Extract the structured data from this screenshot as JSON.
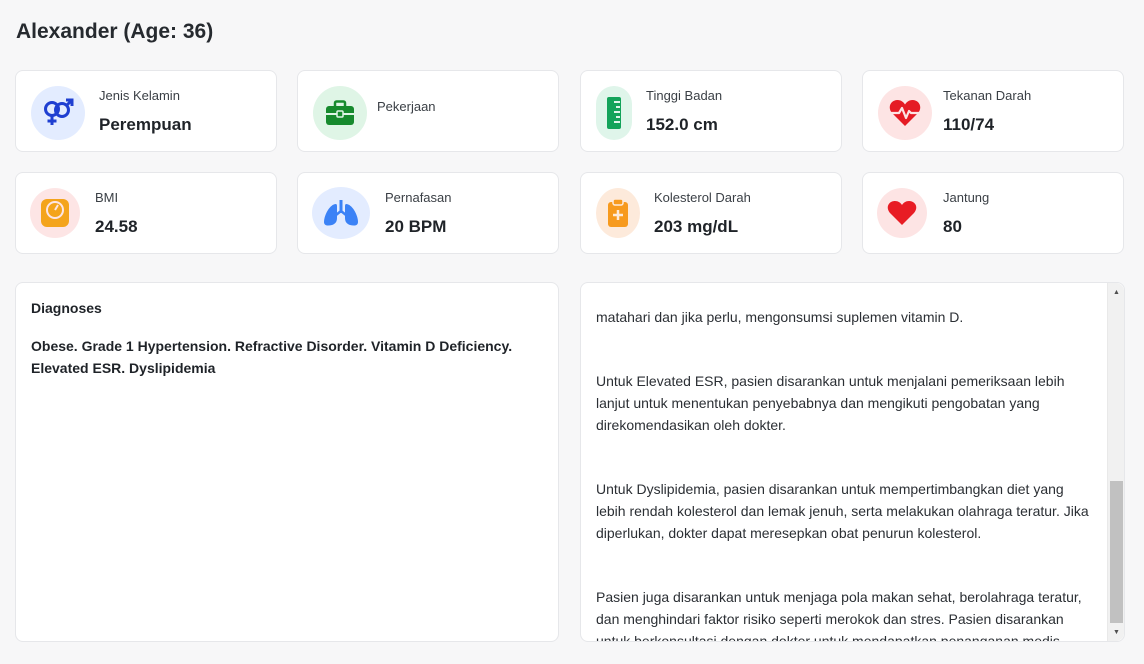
{
  "patient": {
    "title": "Alexander (Age: 36)"
  },
  "cards": [
    {
      "name": "gender",
      "label": "Jenis Kelamin",
      "value": "Perempuan",
      "icon": "gender-icon",
      "bg": "#e3ecff",
      "color": "#1f3fd1"
    },
    {
      "name": "occupation",
      "label": "Pekerjaan",
      "value": "",
      "icon": "briefcase-icon",
      "bg": "#dff5e6",
      "color": "#168a2d"
    },
    {
      "name": "height",
      "label": "Tinggi Badan",
      "value": "152.0 cm",
      "icon": "ruler-icon",
      "bg": "#dff5ea",
      "color": "#13a35a"
    },
    {
      "name": "blood-pressure",
      "label": "Tekanan Darah",
      "value": "110/74",
      "icon": "heart-pulse-icon",
      "bg": "#fde4e4",
      "color": "#e51b24"
    },
    {
      "name": "bmi",
      "label": "BMI",
      "value": "24.58",
      "icon": "scale-icon",
      "bg": "#fde5e5",
      "color": "#f4a41c"
    },
    {
      "name": "respiration",
      "label": "Pernafasan",
      "value": "20 BPM",
      "icon": "lungs-icon",
      "bg": "#e3ecff",
      "color": "#3b82f6"
    },
    {
      "name": "cholesterol",
      "label": "Kolesterol Darah",
      "value": "203 mg/dL",
      "icon": "clipboard-plus-icon",
      "bg": "#fdeadb",
      "color": "#f79a1e"
    },
    {
      "name": "heart-rate",
      "label": "Jantung",
      "value": "80",
      "icon": "heart-icon",
      "bg": "#fde4e4",
      "color": "#e81c24"
    }
  ],
  "diagnoses": {
    "title": "Diagnoses",
    "text": "Obese. Grade 1 Hypertension. Refractive Disorder. Vitamin D Deficiency. Elevated ESR. Dyslipidemia"
  },
  "recommendations": {
    "paragraphs": [
      "matahari dan jika perlu, mengonsumsi suplemen vitamin D.",
      "Untuk Elevated ESR, pasien disarankan untuk menjalani pemeriksaan lebih lanjut untuk menentukan penyebabnya dan mengikuti pengobatan yang direkomendasikan oleh dokter.",
      "Untuk Dyslipidemia, pasien disarankan untuk mempertimbangkan diet yang lebih rendah kolesterol dan lemak jenuh, serta melakukan olahraga teratur. Jika diperlukan, dokter dapat meresepkan obat penurun kolesterol.",
      "Pasien juga disarankan untuk menjaga pola makan sehat, berolahraga teratur, dan menghindari faktor risiko seperti merokok dan stres. Pasien disarankan untuk berkonsultasi dengan dokter untuk mendapatkan penanganan medis yang tepat dan mengikuti rencana perawatan yang disarankan."
    ]
  }
}
